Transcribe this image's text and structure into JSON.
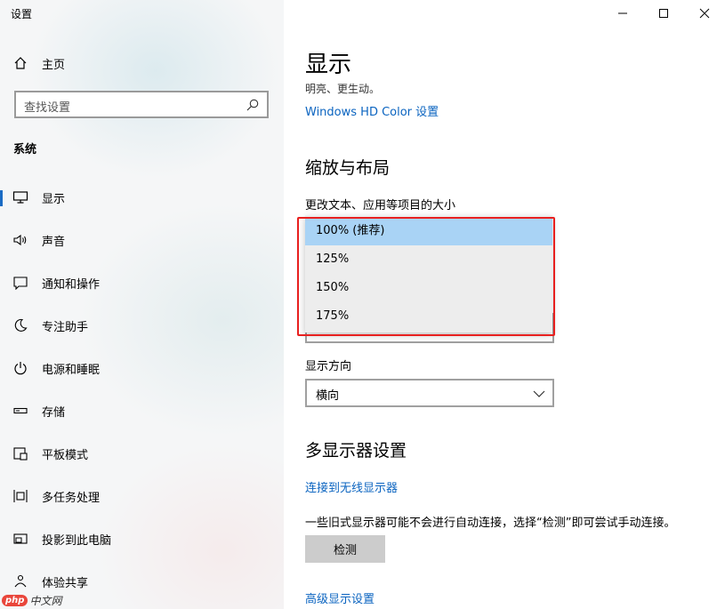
{
  "window": {
    "title": "设置"
  },
  "sidebar": {
    "home": {
      "label": "主页",
      "icon": "home-icon"
    },
    "search": {
      "placeholder": "查找设置",
      "icon": "search-icon"
    },
    "section_label": "系统",
    "items": [
      {
        "label": "显示",
        "icon": "monitor-icon",
        "active": true
      },
      {
        "label": "声音",
        "icon": "speaker-icon"
      },
      {
        "label": "通知和操作",
        "icon": "message-icon"
      },
      {
        "label": "专注助手",
        "icon": "moon-icon"
      },
      {
        "label": "电源和睡眠",
        "icon": "power-icon"
      },
      {
        "label": "存储",
        "icon": "storage-icon"
      },
      {
        "label": "平板模式",
        "icon": "tablet-icon"
      },
      {
        "label": "多任务处理",
        "icon": "multitask-icon"
      },
      {
        "label": "投影到此电脑",
        "icon": "project-icon"
      },
      {
        "label": "体验共享",
        "icon": "share-icon"
      }
    ]
  },
  "main": {
    "title": "显示",
    "subtitle": "明亮、更生动。",
    "hdr_link": "Windows HD Color 设置",
    "scale_section": {
      "heading": "缩放与布局",
      "scale_label": "更改文本、应用等项目的大小",
      "scale_options": [
        "100% (推荐)",
        "125%",
        "150%",
        "175%"
      ],
      "scale_selected": "100% (推荐)",
      "orientation_label": "显示方向",
      "orientation_value": "横向"
    },
    "multi_section": {
      "heading": "多显示器设置",
      "wireless_link": "连接到无线显示器",
      "description": "一些旧式显示器可能不会进行自动连接，选择“检测”即可尝试手动连接。",
      "detect_button": "检测",
      "advanced_link": "高级显示设置"
    }
  },
  "watermark": {
    "badge": "php",
    "text": "中文网"
  },
  "colors": {
    "accent": "#0b64c0",
    "selection": "#a9d3f5",
    "highlight": "#e8201f"
  }
}
